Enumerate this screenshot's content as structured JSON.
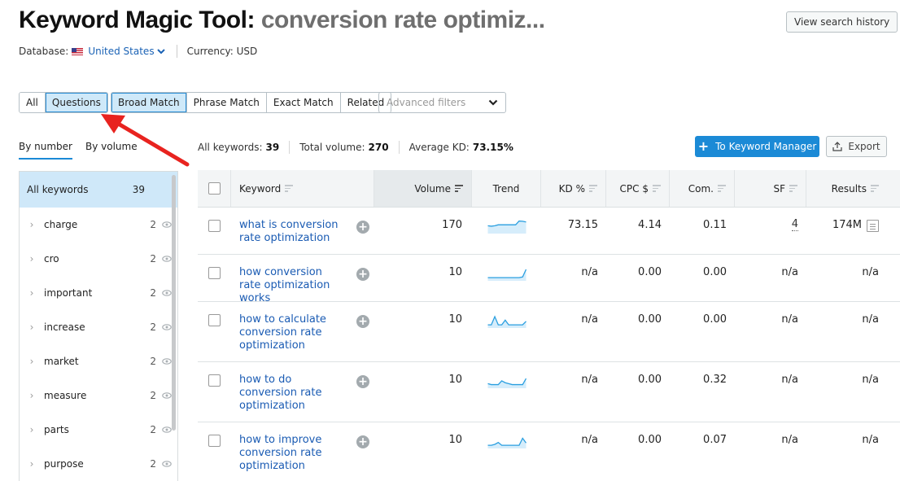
{
  "header": {
    "title": "Keyword Magic Tool:",
    "query": "conversion rate optimiz...",
    "database_label": "Database:",
    "database_value": "United States",
    "currency_label": "Currency: USD",
    "history_button": "View search history"
  },
  "filters": {
    "type_tabs": [
      {
        "label": "All",
        "active": false
      },
      {
        "label": "Questions",
        "active": true
      }
    ],
    "match_tabs": [
      {
        "label": "Broad Match",
        "active": true
      },
      {
        "label": "Phrase Match",
        "active": false
      },
      {
        "label": "Exact Match",
        "active": false
      },
      {
        "label": "Related",
        "active": false
      }
    ],
    "advanced_placeholder": "Advanced filters"
  },
  "sidebar": {
    "tabs": [
      {
        "label": "By number",
        "active": true
      },
      {
        "label": "By volume",
        "active": false
      }
    ],
    "all": {
      "label": "All keywords",
      "count": "39"
    },
    "items": [
      {
        "label": "charge",
        "count": "2"
      },
      {
        "label": "cro",
        "count": "2"
      },
      {
        "label": "important",
        "count": "2"
      },
      {
        "label": "increase",
        "count": "2"
      },
      {
        "label": "market",
        "count": "2"
      },
      {
        "label": "measure",
        "count": "2"
      },
      {
        "label": "parts",
        "count": "2"
      },
      {
        "label": "purpose",
        "count": "2"
      }
    ]
  },
  "stats": {
    "all_keywords_label": "All keywords:",
    "all_keywords_value": "39",
    "total_volume_label": "Total volume:",
    "total_volume_value": "270",
    "avg_kd_label": "Average KD:",
    "avg_kd_value": "73.15%"
  },
  "actions": {
    "keyword_manager": "To Keyword Manager",
    "export": "Export"
  },
  "table": {
    "columns": [
      "Keyword",
      "Volume",
      "Trend",
      "KD %",
      "CPC $",
      "Com.",
      "SF",
      "Results"
    ],
    "rows": [
      {
        "keyword": "what is conversion rate optimization",
        "volume": "170",
        "trend": [
          3,
          2.8,
          3,
          3.4,
          3.4,
          3.4,
          3.4,
          3.4,
          3.4,
          5,
          4.9,
          4.6
        ],
        "kd": "73.15",
        "cpc": "4.14",
        "com": "0.11",
        "sf": "4",
        "results": "174M"
      },
      {
        "keyword": "how conversion rate optimization works",
        "volume": "10",
        "trend": [
          1,
          1,
          1,
          1,
          1,
          1,
          1,
          1,
          1,
          1,
          1.3,
          4.5
        ],
        "kd": "n/a",
        "cpc": "0.00",
        "com": "0.00",
        "sf": "n/a",
        "results": "n/a"
      },
      {
        "keyword": "how to calculate conversion rate optimization",
        "volume": "10",
        "trend": [
          1,
          1,
          4.5,
          1,
          1,
          3,
          1,
          1,
          1,
          1,
          1,
          2.5
        ],
        "kd": "n/a",
        "cpc": "0.00",
        "com": "0.00",
        "sf": "n/a",
        "results": "n/a"
      },
      {
        "keyword": "how to do conversion rate optimization",
        "volume": "10",
        "trend": [
          1.6,
          1.2,
          1.2,
          1.2,
          2.8,
          2,
          1.6,
          1.2,
          1.2,
          1.2,
          1.2,
          3.8
        ],
        "kd": "n/a",
        "cpc": "0.00",
        "com": "0.32",
        "sf": "n/a",
        "results": "n/a"
      },
      {
        "keyword": "how to improve conversion rate optimization",
        "volume": "10",
        "trend": [
          1,
          1,
          1.4,
          2.2,
          1,
          1,
          1,
          1,
          1,
          1,
          4,
          2
        ],
        "kd": "n/a",
        "cpc": "0.00",
        "com": "0.07",
        "sf": "n/a",
        "results": "n/a"
      }
    ]
  },
  "colors": {
    "accent": "#1b8ad6",
    "link": "#1a5bb3",
    "active_tab_bg": "#cfe9f9",
    "trend_line": "#2a9fe0",
    "trend_fill": "#d6edfb",
    "annotation_arrow": "#e8231f"
  }
}
